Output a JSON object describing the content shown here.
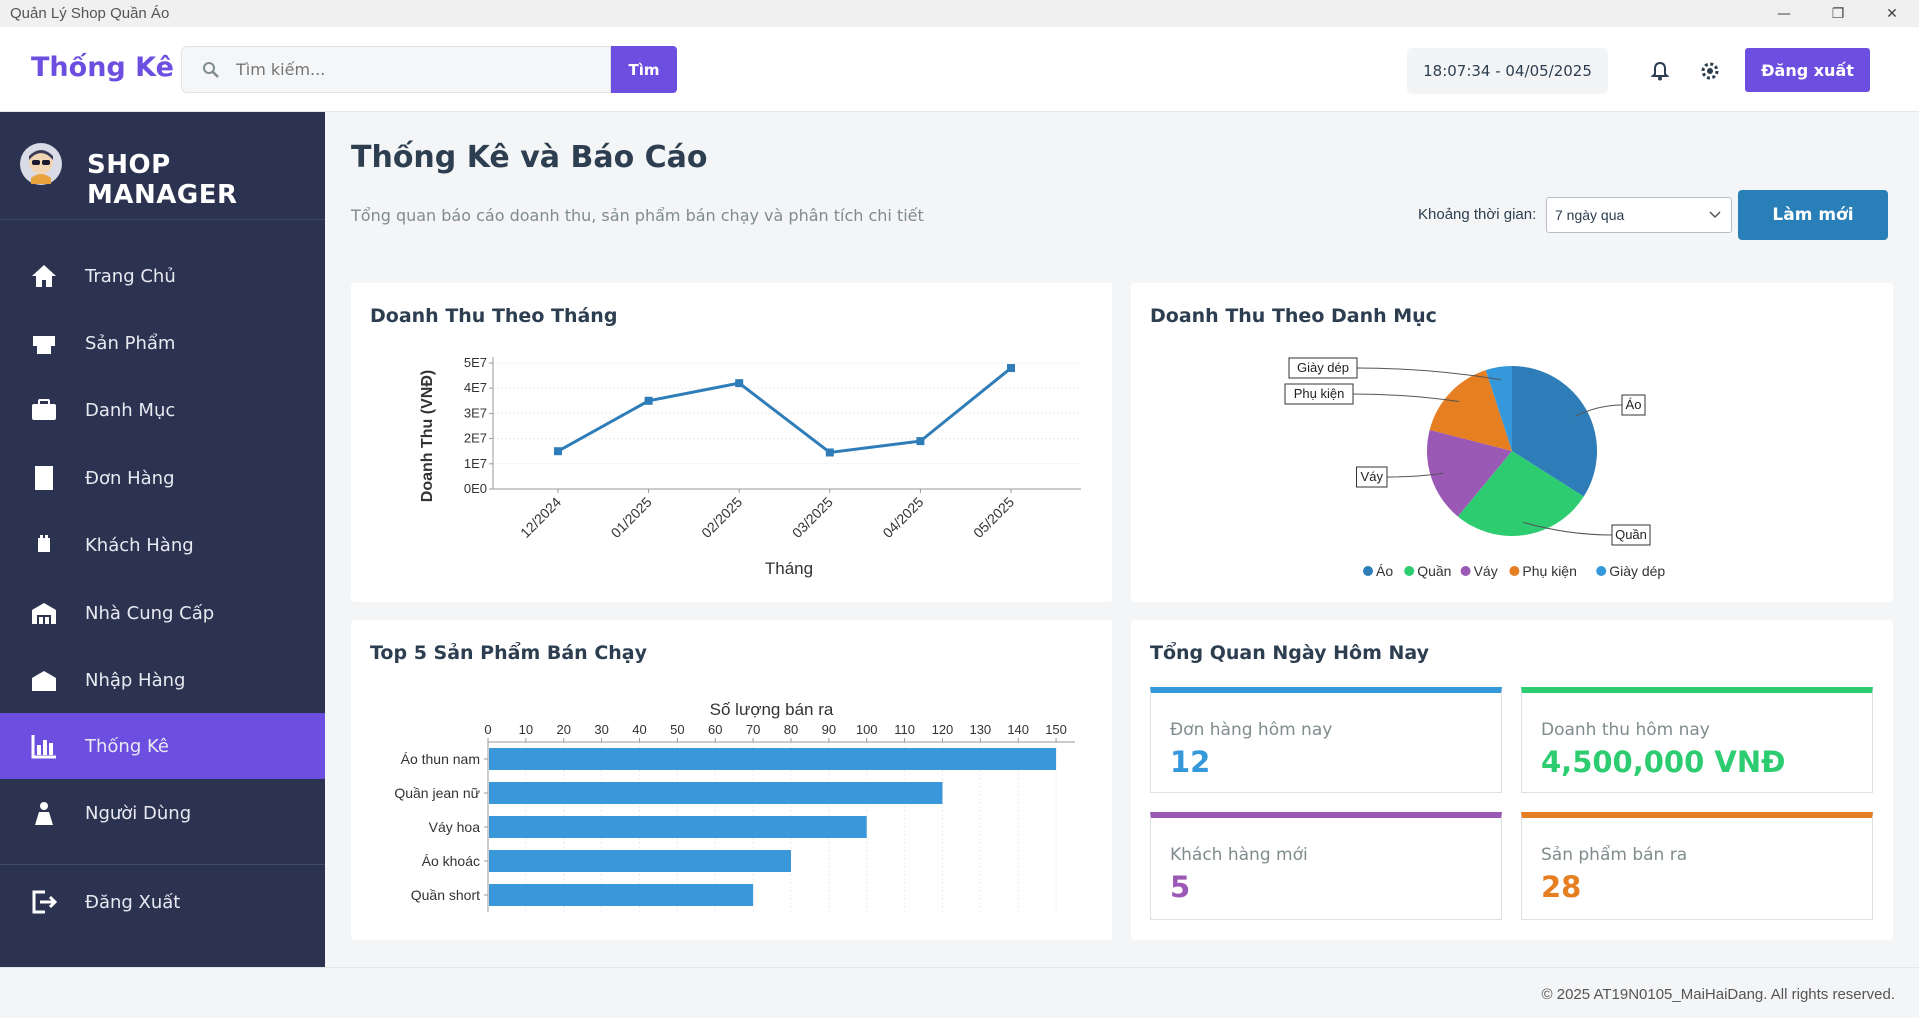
{
  "window": {
    "title": "Quản Lý Shop Quần Áo"
  },
  "header": {
    "page_label": "Thống Kê",
    "search_placeholder": "Tìm kiếm...",
    "search_button": "Tìm",
    "clock": "18:07:34 - 04/05/2025",
    "logout_button": "Đăng xuất"
  },
  "sidebar": {
    "brand": "SHOP MANAGER",
    "items": [
      {
        "label": "Trang Chủ",
        "icon": "home-icon"
      },
      {
        "label": "Sản Phẩm",
        "icon": "shirt-icon"
      },
      {
        "label": "Danh Mục",
        "icon": "folder-icon"
      },
      {
        "label": "Đơn Hàng",
        "icon": "receipt-icon"
      },
      {
        "label": "Khách Hàng",
        "icon": "users-icon"
      },
      {
        "label": "Nhà Cung Cấp",
        "icon": "warehouse-icon"
      },
      {
        "label": "Nhập Hàng",
        "icon": "box-icon"
      },
      {
        "label": "Thống Kê",
        "icon": "bar-chart-icon",
        "active": true
      },
      {
        "label": "Người Dùng",
        "icon": "user-icon"
      }
    ],
    "logout": {
      "label": "Đăng Xuất",
      "icon": "sign-out-icon"
    }
  },
  "main": {
    "title": "Thống Kê và Báo Cáo",
    "subtitle": "Tổng quan báo cáo doanh thu, sản phẩm bán chạy và phân tích chi tiết",
    "period_label": "Khoảng thời gian:",
    "period_value": "7 ngày qua",
    "refresh_button": "Làm mới"
  },
  "cards": {
    "monthly_title": "Doanh Thu Theo Tháng",
    "category_title": "Doanh Thu Theo Danh Mục",
    "top_title": "Top 5 Sản Phẩm Bán Chạy",
    "today_title": "Tổng Quan Ngày Hôm Nay"
  },
  "stats": [
    {
      "label": "Đơn hàng hôm nay",
      "value": "12",
      "color": "#3498db"
    },
    {
      "label": "Doanh thu hôm nay",
      "value": "4,500,000 VNĐ",
      "color": "#2ecc71"
    },
    {
      "label": "Khách hàng mới",
      "value": "5",
      "color": "#9b59b6"
    },
    {
      "label": "Sản phẩm bán ra",
      "value": "28",
      "color": "#e67e22"
    }
  ],
  "footer": {
    "copyright": "© 2025 AT19N0105_MaiHaiDang. All rights reserved."
  },
  "chart_data": [
    {
      "type": "line",
      "title": "Doanh Thu Theo Tháng",
      "xlabel": "Tháng",
      "ylabel": "Doanh Thu (VNĐ)",
      "categories": [
        "12/2024",
        "01/2025",
        "02/2025",
        "03/2025",
        "04/2025",
        "05/2025"
      ],
      "values": [
        15000000,
        35000000,
        42000000,
        14500000,
        19000000,
        48000000
      ],
      "yticks": [
        "0E0",
        "1E7",
        "2E7",
        "3E7",
        "4E7",
        "5E7"
      ],
      "ylim": [
        0,
        50000000
      ],
      "color": "#2e7cb8",
      "grid": true
    },
    {
      "type": "pie",
      "title": "Doanh Thu Theo Danh Mục",
      "labels": [
        "Áo",
        "Quần",
        "Váy",
        "Phụ kiện",
        "Giày dép"
      ],
      "values": [
        34,
        27,
        18,
        16,
        5
      ],
      "colors": [
        "#2e7cb8",
        "#2ecc71",
        "#9b59b6",
        "#e67e22",
        "#3498db"
      ],
      "legend": "bottom"
    },
    {
      "type": "bar",
      "orientation": "horizontal",
      "title": "Top 5 Sản Phẩm Bán Chạy",
      "xlabel": "Số lượng bán ra",
      "categories": [
        "Áo thun nam",
        "Quần jean nữ",
        "Váy hoa",
        "Áo khoác",
        "Quần short"
      ],
      "values": [
        150,
        120,
        100,
        80,
        70
      ],
      "xlim": [
        0,
        155
      ],
      "xticks": [
        0,
        10,
        20,
        30,
        40,
        50,
        60,
        70,
        80,
        90,
        100,
        110,
        120,
        130,
        140,
        150
      ],
      "color": "#3a97d9",
      "grid": true
    }
  ]
}
